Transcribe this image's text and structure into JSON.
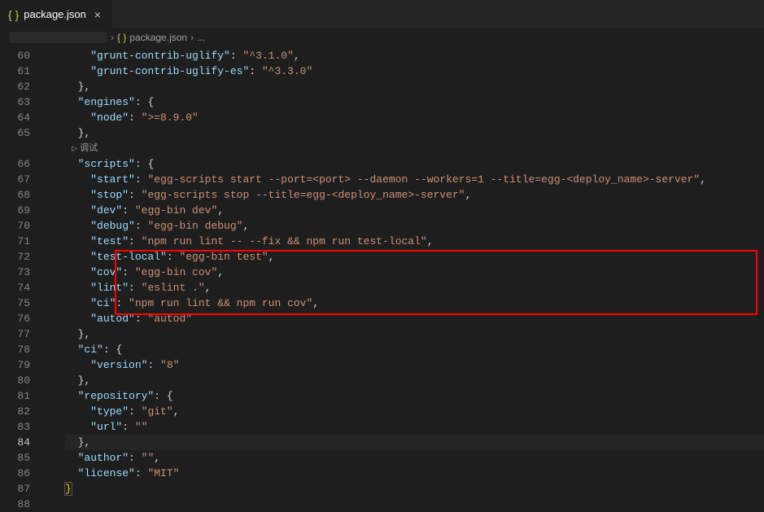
{
  "tab": {
    "filename": "package.json",
    "icon_glyph": "{ }"
  },
  "breadcrumb": {
    "filename": "package.json",
    "tail": "...",
    "sep": "›",
    "icon_glyph": "{ }"
  },
  "codelens": {
    "label": "调试",
    "tri": "▷"
  },
  "line_numbers": [
    "60",
    "61",
    "62",
    "63",
    "64",
    "65",
    "",
    "66",
    "67",
    "68",
    "69",
    "70",
    "71",
    "72",
    "73",
    "74",
    "75",
    "76",
    "77",
    "78",
    "79",
    "80",
    "81",
    "82",
    "83",
    "84",
    "85",
    "86",
    "87",
    "88"
  ],
  "active_line": "84",
  "code": {
    "l60": {
      "indent": "    ",
      "key": "\"grunt-contrib-uglify\"",
      "sep": ": ",
      "val": "\"^3.1.0\"",
      "trail": ","
    },
    "l61": {
      "indent": "    ",
      "key": "\"grunt-contrib-uglify-es\"",
      "sep": ": ",
      "val": "\"^3.3.0\""
    },
    "l62": {
      "indent": "  ",
      "brace": "},"
    },
    "l63": {
      "indent": "  ",
      "key": "\"engines\"",
      "sep": ": ",
      "brace": "{"
    },
    "l64": {
      "indent": "    ",
      "key": "\"node\"",
      "sep": ": ",
      "val": "\">=8.9.0\""
    },
    "l65": {
      "indent": "  ",
      "brace": "},"
    },
    "l66": {
      "indent": "  ",
      "key": "\"scripts\"",
      "sep": ": ",
      "brace": "{"
    },
    "l67": {
      "indent": "    ",
      "key": "\"start\"",
      "sep": ": ",
      "val": "\"egg-scripts start --port=<port> --daemon --workers=1 --title=egg-<deploy_name>-server\"",
      "trail": ","
    },
    "l68": {
      "indent": "    ",
      "key": "\"stop\"",
      "sep": ": ",
      "val": "\"egg-scripts stop --title=egg-<deploy_name>-server\"",
      "trail": ","
    },
    "l69": {
      "indent": "    ",
      "key": "\"dev\"",
      "sep": ": ",
      "val": "\"egg-bin dev\"",
      "trail": ","
    },
    "l70": {
      "indent": "    ",
      "key": "\"debug\"",
      "sep": ": ",
      "val": "\"egg-bin debug\"",
      "trail": ","
    },
    "l71": {
      "indent": "    ",
      "key": "\"test\"",
      "sep": ": ",
      "val": "\"npm run lint -- --fix && npm run test-local\"",
      "trail": ","
    },
    "l72": {
      "indent": "    ",
      "key": "\"test-local\"",
      "sep": ": ",
      "val": "\"egg-bin test\"",
      "trail": ","
    },
    "l73": {
      "indent": "    ",
      "key": "\"cov\"",
      "sep": ": ",
      "val": "\"egg-bin cov\"",
      "trail": ","
    },
    "l74": {
      "indent": "    ",
      "key": "\"lint\"",
      "sep": ": ",
      "val": "\"eslint .\"",
      "trail": ","
    },
    "l75": {
      "indent": "    ",
      "key": "\"ci\"",
      "sep": ": ",
      "val": "\"npm run lint && npm run cov\"",
      "trail": ","
    },
    "l76": {
      "indent": "    ",
      "key": "\"autod\"",
      "sep": ": ",
      "val": "\"autod\""
    },
    "l77": {
      "indent": "  ",
      "brace": "},"
    },
    "l78": {
      "indent": "  ",
      "key": "\"ci\"",
      "sep": ": ",
      "brace": "{"
    },
    "l79": {
      "indent": "    ",
      "key": "\"version\"",
      "sep": ": ",
      "val": "\"8\""
    },
    "l80": {
      "indent": "  ",
      "brace": "},"
    },
    "l81": {
      "indent": "  ",
      "key": "\"repository\"",
      "sep": ": ",
      "brace": "{"
    },
    "l82": {
      "indent": "    ",
      "key": "\"type\"",
      "sep": ": ",
      "val": "\"git\"",
      "trail": ","
    },
    "l83": {
      "indent": "    ",
      "key": "\"url\"",
      "sep": ": ",
      "val": "\"\""
    },
    "l84": {
      "indent": "  ",
      "brace": "},"
    },
    "l85": {
      "indent": "  ",
      "key": "\"author\"",
      "sep": ": ",
      "val": "\"\"",
      "trail": ","
    },
    "l86": {
      "indent": "  ",
      "key": "\"license\"",
      "sep": ": ",
      "val": "\"MIT\""
    },
    "l87": {
      "indent": "",
      "brace": "}",
      "boxed": true
    },
    "l88": {
      "indent": "",
      "empty": true
    }
  }
}
